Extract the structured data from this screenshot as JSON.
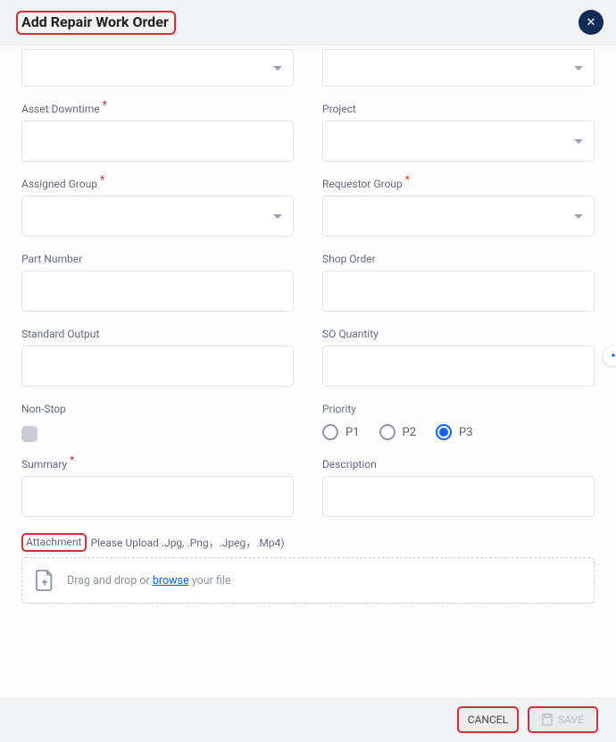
{
  "header": {
    "title": "Add Repair Work Order"
  },
  "fields": {
    "asset_downtime": {
      "label": "Asset Downtime",
      "required": true,
      "value": ""
    },
    "project": {
      "label": "Project",
      "required": false,
      "value": ""
    },
    "assigned_group": {
      "label": "Assigned Group",
      "required": true,
      "value": ""
    },
    "requestor_group": {
      "label": "Requestor Group",
      "required": true,
      "value": ""
    },
    "part_number": {
      "label": "Part Number",
      "required": false,
      "value": ""
    },
    "shop_order": {
      "label": "Shop Order",
      "required": false,
      "value": ""
    },
    "standard_output": {
      "label": "Standard Output",
      "required": false,
      "value": ""
    },
    "so_quantity": {
      "label": "SO Quantity",
      "required": false,
      "value": ""
    },
    "non_stop": {
      "label": "Non-Stop",
      "checked": false
    },
    "priority": {
      "label": "Priority",
      "options": [
        "P1",
        "P2",
        "P3"
      ],
      "selected": "P3"
    },
    "summary": {
      "label": "Summary",
      "required": true,
      "value": ""
    },
    "description": {
      "label": "Description",
      "required": false,
      "value": ""
    }
  },
  "attachment": {
    "label": "Attachment",
    "hint": "Please Upload .Jpg, .Png，.Jpeg，.Mp4)",
    "drop_prefix": "Drag and drop or ",
    "browse": "browse",
    "drop_suffix": " your file"
  },
  "footer": {
    "cancel": "CANCEL",
    "save": "SAVE"
  }
}
